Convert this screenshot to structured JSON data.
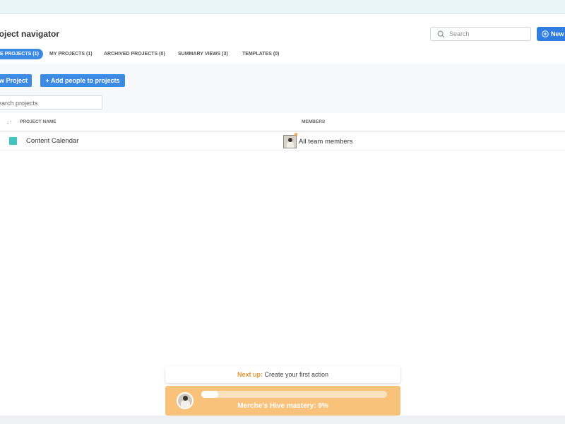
{
  "header": {
    "title": "roject navigator",
    "search_placeholder": "Search",
    "new_label": "New"
  },
  "tabs": [
    {
      "label": "E PROJECTS (1)",
      "active": true
    },
    {
      "label": "MY PROJECTS (1)",
      "active": false
    },
    {
      "label": "ARCHIVED PROJECTS (0)",
      "active": false
    },
    {
      "label": "SUMMARY VIEWS (3)",
      "active": false
    },
    {
      "label": "TEMPLATES (0)",
      "active": false
    }
  ],
  "toolbar": {
    "new_project_label": "w Project",
    "add_people_label": "+ Add people to projects",
    "search_placeholder": "earch projects"
  },
  "table": {
    "sort_icon": "↓↑",
    "columns": {
      "project_name": "PROJECT NAME",
      "members": "MEMBERS"
    },
    "rows": [
      {
        "name": "Content Calendar",
        "color": "#40c5c2",
        "members": "All team members"
      }
    ]
  },
  "onboarding": {
    "next_up_label": "Next up:",
    "next_up_value": "Create your first action",
    "mastery_text": "Merche's Hive mastery: 9%",
    "mastery_percent": 9
  },
  "colors": {
    "accent": "#2f7de1",
    "tab_active": "#3d8ae5",
    "mastery_bg": "#f8c27b",
    "next_up_accent": "#e39530"
  }
}
